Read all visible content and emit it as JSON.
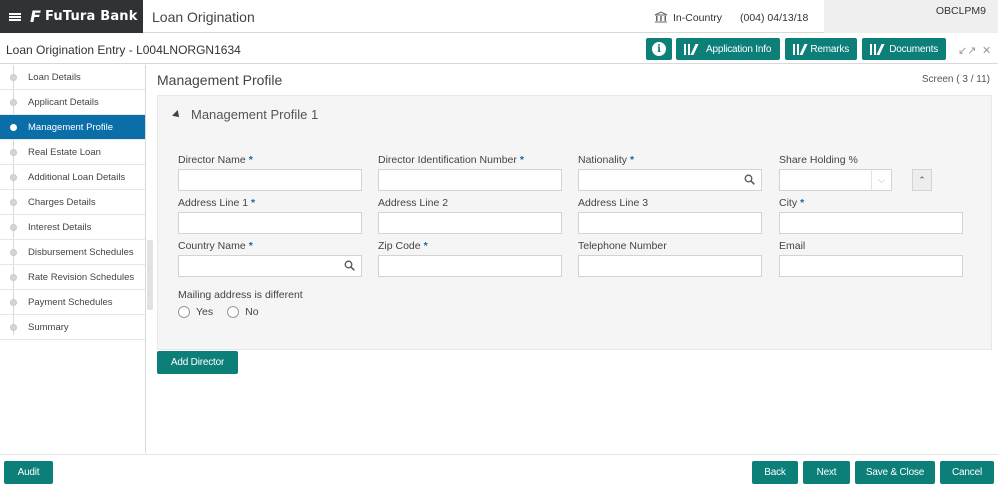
{
  "topbar": {
    "bank_name": "FuTura Bank",
    "logo_glyph": "F",
    "app_title": "Loan Origination",
    "country": "In-Country",
    "branch_date": "(004)  04/13/18",
    "user_id": "OBCLPM9"
  },
  "header": {
    "entry_title": "Loan Origination Entry - L004LNORGN1634",
    "info_label": "i",
    "app_info_label": "Application Info",
    "remarks_label": "Remarks",
    "documents_label": "Documents",
    "minimize_glyph": "↙↗",
    "close_glyph": "✕"
  },
  "sidebar": {
    "items": [
      {
        "label": "Loan Details",
        "active": false
      },
      {
        "label": "Applicant Details",
        "active": false
      },
      {
        "label": "Management Profile",
        "active": true
      },
      {
        "label": "Real Estate Loan",
        "active": false
      },
      {
        "label": "Additional Loan Details",
        "active": false
      },
      {
        "label": "Charges Details",
        "active": false
      },
      {
        "label": "Interest Details",
        "active": false
      },
      {
        "label": "Disbursement Schedules",
        "active": false
      },
      {
        "label": "Rate Revision Schedules",
        "active": false
      },
      {
        "label": "Payment Schedules",
        "active": false
      },
      {
        "label": "Summary",
        "active": false
      }
    ]
  },
  "main": {
    "title": "Management Profile",
    "screen_count": "Screen ( 3 / 11)",
    "panel_title": "Management Profile 1",
    "fields": {
      "director_name": {
        "label": "Director Name",
        "value": ""
      },
      "director_id": {
        "label": "Director Identification Number",
        "value": ""
      },
      "nationality": {
        "label": "Nationality",
        "value": ""
      },
      "share_holding": {
        "label": "Share Holding %",
        "value": ""
      },
      "address1": {
        "label": "Address Line 1",
        "value": ""
      },
      "address2": {
        "label": "Address Line 2",
        "value": ""
      },
      "address3": {
        "label": "Address Line 3",
        "value": ""
      },
      "city": {
        "label": "City",
        "value": ""
      },
      "country_name": {
        "label": "Country Name",
        "value": ""
      },
      "zip_code": {
        "label": "Zip Code",
        "value": ""
      },
      "telephone": {
        "label": "Telephone Number",
        "value": ""
      },
      "email": {
        "label": "Email",
        "value": ""
      }
    },
    "required_mark": "*",
    "mailing_label": "Mailing address is different",
    "radio_yes": "Yes",
    "radio_no": "No",
    "add_director_label": "Add Director"
  },
  "footer": {
    "audit_label": "Audit",
    "back_label": "Back",
    "next_label": "Next",
    "save_close_label": "Save & Close",
    "cancel_label": "Cancel"
  },
  "colors": {
    "primary_button": "#0c7f79",
    "active_step": "#0a6ea8",
    "brand_bar": "#2f3336"
  }
}
